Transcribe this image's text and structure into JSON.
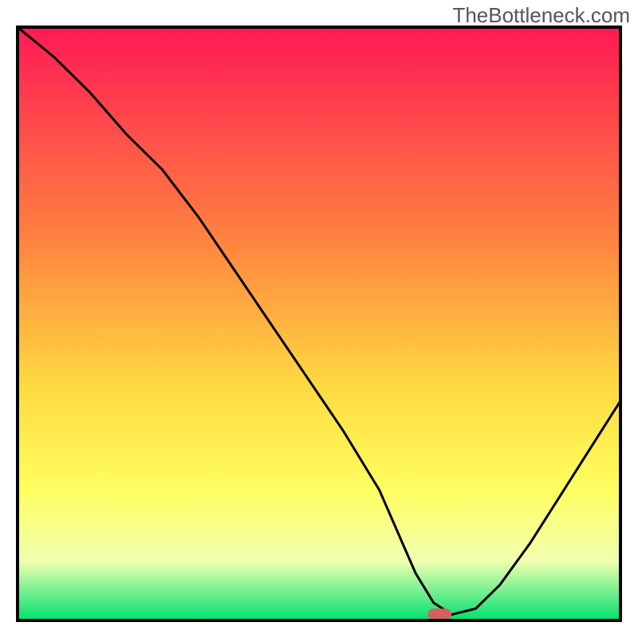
{
  "watermark": "TheBottleneck.com",
  "colors": {
    "gradient_top": "#ff1a55",
    "gradient_mid1": "#ff8040",
    "gradient_mid2": "#ffd840",
    "gradient_mid3": "#ffff60",
    "gradient_mid4": "#f0ffb0",
    "gradient_bottom": "#00e070",
    "curve": "#000000",
    "marker_fill": "#d66060",
    "frame": "#000000"
  },
  "chart_data": {
    "type": "line",
    "title": "",
    "xlabel": "",
    "ylabel": "",
    "xlim": [
      0,
      100
    ],
    "ylim": [
      0,
      100
    ],
    "grid": false,
    "legend": false,
    "series": [
      {
        "name": "bottleneck-curve",
        "x": [
          0,
          6,
          12,
          18,
          24,
          30,
          36,
          42,
          48,
          54,
          60,
          63,
          66,
          69,
          72,
          76,
          80,
          85,
          90,
          95,
          100
        ],
        "values": [
          100,
          95,
          89,
          82,
          76,
          68,
          59,
          50,
          41,
          32,
          22,
          15,
          8,
          3,
          1,
          2,
          6,
          13,
          21,
          29,
          37
        ]
      }
    ],
    "marker": {
      "x": 70,
      "y": 1,
      "w": 4,
      "h": 2
    },
    "background": {
      "type": "vertical-gradient",
      "stops": [
        {
          "pos": 0.0,
          "color": "#ff1a55"
        },
        {
          "pos": 0.35,
          "color": "#ff8040"
        },
        {
          "pos": 0.6,
          "color": "#ffd840"
        },
        {
          "pos": 0.78,
          "color": "#ffff60"
        },
        {
          "pos": 0.9,
          "color": "#f0ffb0"
        },
        {
          "pos": 1.0,
          "color": "#00e070"
        }
      ]
    }
  }
}
